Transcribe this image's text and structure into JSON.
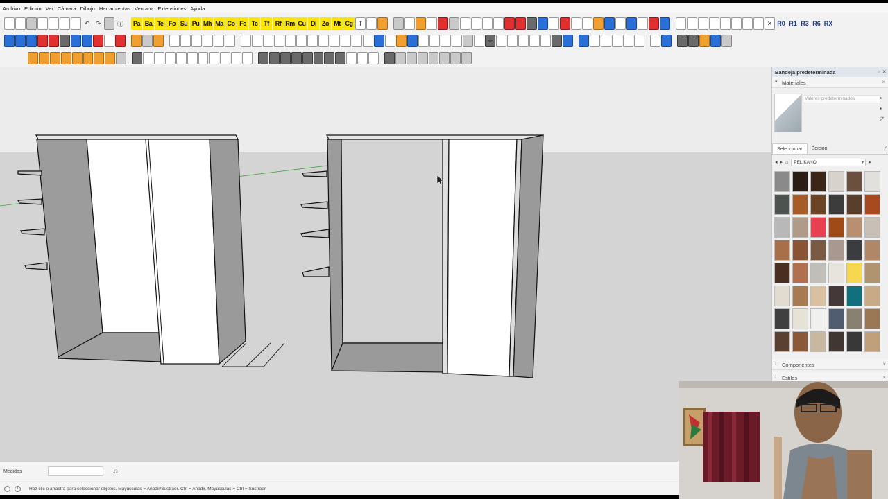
{
  "menu": [
    "Archivo",
    "Edición",
    "Ver",
    "Cámara",
    "Dibujo",
    "Herramientas",
    "Ventana",
    "Extensiones",
    "Ayuda"
  ],
  "toolbar_yellow": [
    "Pa",
    "Ba",
    "Te",
    "Fo",
    "Su",
    "Pu",
    "Mh",
    "Ma",
    "Co",
    "Fc",
    "Tc",
    "Tf",
    "Rf",
    "Rm",
    "Cu",
    "Di",
    "Zo",
    "Mt",
    "Cg"
  ],
  "toolbar_rotate": [
    "R0",
    "R1",
    "R3",
    "R6",
    "RX"
  ],
  "panel": {
    "title": "Bandeja predeterminada",
    "materials_header": "Materiales",
    "material_name_placeholder": "Valores predeterminados",
    "tab_select": "Seleccionar",
    "tab_edit": "Edición",
    "library": "PELIKANO",
    "components_header": "Componentes",
    "styles_header": "Estilos"
  },
  "swatch_colors": [
    "#8a8a8a",
    "#2c1d14",
    "#3b2418",
    "#d8d2cc",
    "#6b5040",
    "#e2e0dc",
    "#4d5450",
    "#a65c28",
    "#6b4426",
    "#3c3c3c",
    "#5a3e2c",
    "#a84a20",
    "#b8b8b8",
    "#b09a88",
    "#e84050",
    "#a04a18",
    "#b89070",
    "#c8c0b6",
    "#a87048",
    "#8a5434",
    "#7a5a42",
    "#a89890",
    "#3a3c40",
    "#b08868",
    "#4a2e20",
    "#b07050",
    "#c0beb8",
    "#e6e4dc",
    "#f5d850",
    "#b09470",
    "#e2dcd0",
    "#a87a50",
    "#d8c0a0",
    "#443838",
    "#10707e",
    "#c8aa86",
    "#404040",
    "#e6e2d6",
    "#f0f0ee",
    "#505c70",
    "#888070",
    "#9a7856",
    "#5a4030",
    "#8a5a38",
    "#c8b8a0",
    "#403632",
    "#383838",
    "#c0a07a"
  ],
  "measures": {
    "label": "Medidas",
    "value": ""
  },
  "status": {
    "text": "Haz clic o arrastra para seleccionar objetos. Mayúsculas = Añadir/Sustraer. Ctrl = Añadir. Mayúsculas + Ctrl = Sustraer."
  }
}
